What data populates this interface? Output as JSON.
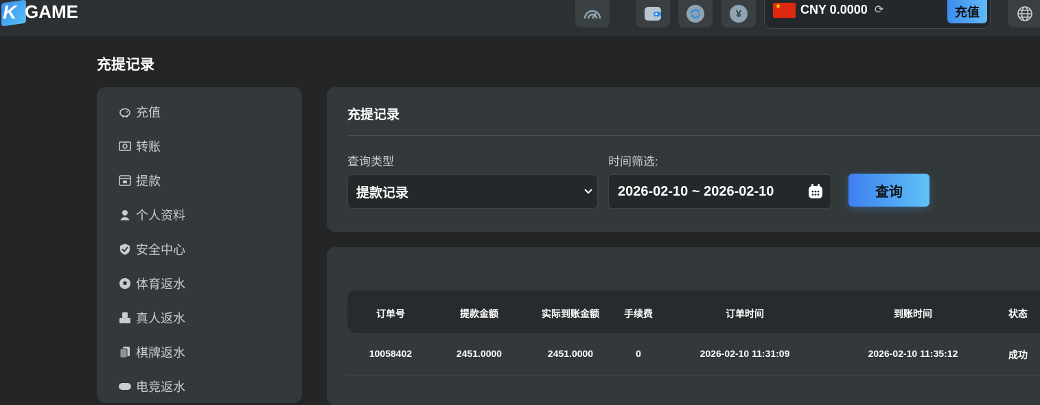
{
  "brand": {
    "logo_k": "K",
    "logo_text": "GAME"
  },
  "header": {
    "currency": "CNY 0.0000",
    "deposit_label": "充值",
    "icons": [
      "signal-icon",
      "wallet-icon",
      "refresh-icon",
      "yuan-icon",
      "refresh-balance-icon",
      "globe-icon"
    ]
  },
  "page": {
    "title": "充提记录"
  },
  "sidebar": {
    "items": [
      {
        "label": "充值",
        "icon": "piggy-bank-icon"
      },
      {
        "label": "转账",
        "icon": "money-transfer-icon"
      },
      {
        "label": "提款",
        "icon": "withdraw-icon"
      },
      {
        "label": "个人资料",
        "icon": "user-icon"
      },
      {
        "label": "安全中心",
        "icon": "shield-icon"
      },
      {
        "label": "体育返水",
        "icon": "soccer-icon"
      },
      {
        "label": "真人返水",
        "icon": "dice-icon"
      },
      {
        "label": "棋牌返水",
        "icon": "cards-icon"
      },
      {
        "label": "电竞返水",
        "icon": "gamepad-icon"
      }
    ]
  },
  "filter": {
    "card_title": "充提记录",
    "type_label": "查询类型",
    "type_value": "提款记录",
    "time_label": "时间筛选:",
    "date_range": "2026-02-10 ~ 2026-02-10",
    "query_label": "查询"
  },
  "table": {
    "headers": [
      "订单号",
      "提款金额",
      "实际到账金额",
      "手续费",
      "订单时间",
      "到账时间",
      "状态"
    ],
    "rows": [
      [
        "10058402",
        "2451.0000",
        "2451.0000",
        "0",
        "2026-02-10 11:31:09",
        "2026-02-10 11:35:12",
        "成功"
      ]
    ]
  },
  "colors": {
    "accent": "#4a9cf2",
    "bg": "#232527",
    "card": "#33393a"
  }
}
